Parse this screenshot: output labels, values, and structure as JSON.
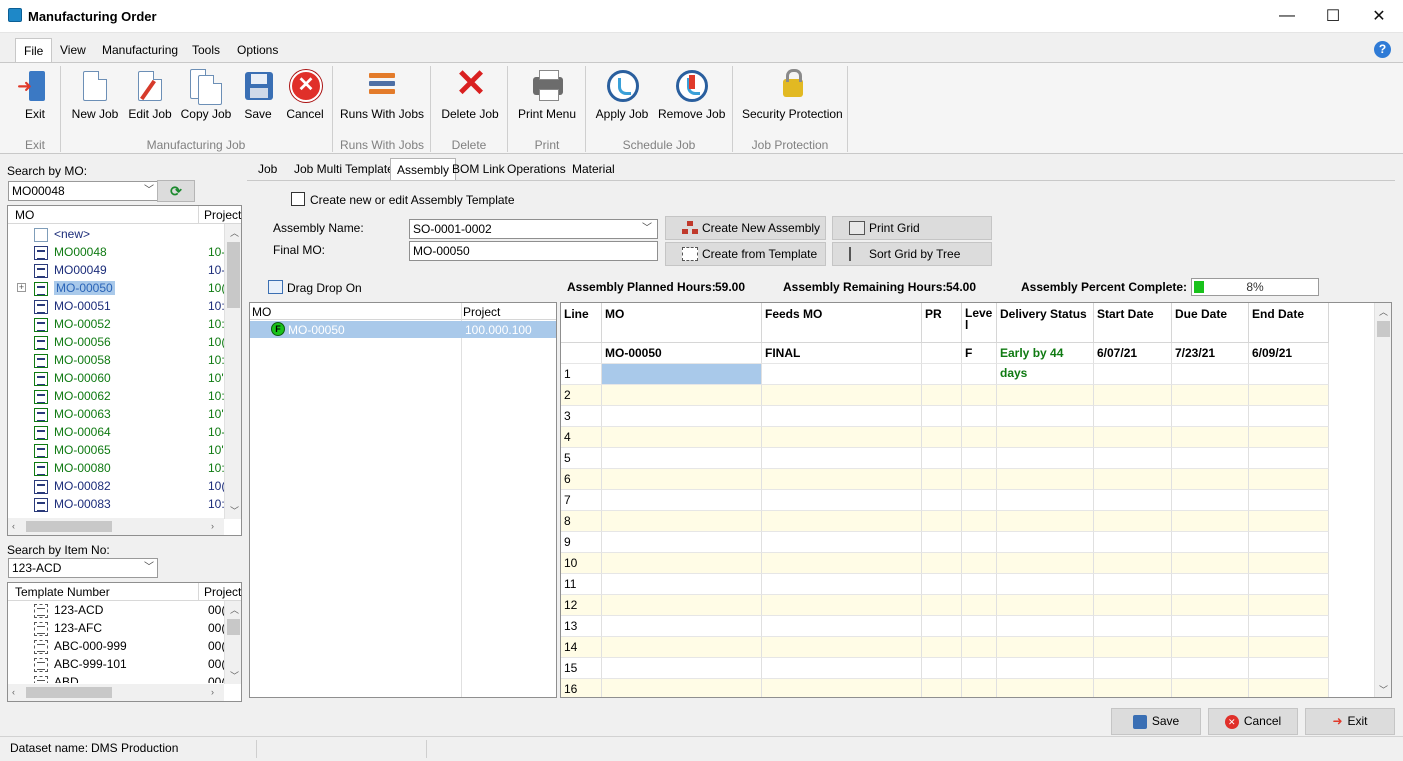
{
  "window": {
    "title": "Manufacturing Order",
    "minimize": "—",
    "maximize": "☐",
    "close": "✕"
  },
  "menu": [
    {
      "label": "File"
    },
    {
      "label": "View"
    },
    {
      "label": "Manufacturing"
    },
    {
      "label": "Tools"
    },
    {
      "label": "Options"
    }
  ],
  "help_icon": "?",
  "ribbon": {
    "buttons": {
      "exit": "Exit",
      "new_job": "New Job",
      "edit_job": "Edit Job",
      "copy_job": "Copy Job",
      "save": "Save",
      "cancel": "Cancel",
      "runs_with_jobs": "Runs With Jobs",
      "delete_job": "Delete Job",
      "print_menu": "Print Menu",
      "apply_job": "Apply Job",
      "remove_job": "Remove Job",
      "security_protection": "Security Protection"
    },
    "groups": {
      "exit": "Exit",
      "manufacturing_job": "Manufacturing Job",
      "runs_with_jobs": "Runs With Jobs",
      "delete": "Delete",
      "print": "Print",
      "schedule_job": "Schedule Job",
      "job_protection": "Job Protection"
    }
  },
  "left": {
    "search_mo_label": "Search by MO:",
    "search_mo_value": "MO00048",
    "mo_tree": {
      "col_mo": "MO",
      "col_project": "Project",
      "rows": [
        {
          "mo": "<new>",
          "project": ""
        },
        {
          "mo": "MO00048",
          "project": "10-"
        },
        {
          "mo": "MO00049",
          "project": "10-"
        },
        {
          "mo": "MO-00050",
          "project": "10("
        },
        {
          "mo": "MO-00051",
          "project": "10:"
        },
        {
          "mo": "MO-00052",
          "project": "10:"
        },
        {
          "mo": "MO-00056",
          "project": "10("
        },
        {
          "mo": "MO-00058",
          "project": "10:"
        },
        {
          "mo": "MO-00060",
          "project": "10'"
        },
        {
          "mo": "MO-00062",
          "project": "10:"
        },
        {
          "mo": "MO-00063",
          "project": "10'"
        },
        {
          "mo": "MO-00064",
          "project": "10-"
        },
        {
          "mo": "MO-00065",
          "project": "10'"
        },
        {
          "mo": "MO-00080",
          "project": "10:"
        },
        {
          "mo": "MO-00082",
          "project": "10("
        },
        {
          "mo": "MO-00083",
          "project": "10:"
        }
      ]
    },
    "search_item_label": "Search by Item No:",
    "search_item_value": "123-ACD",
    "template_tree": {
      "col_template": "Template Number",
      "col_project": "Project",
      "rows": [
        {
          "name": "123-ACD",
          "project": "00("
        },
        {
          "name": "123-AFC",
          "project": "00("
        },
        {
          "name": "ABC-000-999",
          "project": "00("
        },
        {
          "name": "ABC-999-101",
          "project": "00("
        },
        {
          "name": "ABD",
          "project": "00("
        }
      ]
    }
  },
  "tabs": [
    {
      "label": "Job"
    },
    {
      "label": "Job Multi Template"
    },
    {
      "label": "Assembly"
    },
    {
      "label": "BOM Link"
    },
    {
      "label": "Operations"
    },
    {
      "label": "Material"
    }
  ],
  "assembly": {
    "create_template_label": "Create new or edit Assembly Template",
    "assembly_name_label": "Assembly Name:",
    "assembly_name_value": "SO-0001-0002",
    "final_mo_label": "Final MO:",
    "final_mo_value": "MO-00050",
    "buttons": {
      "create_new_assembly": "Create New Assembly",
      "print_grid": "Print Grid",
      "create_from_template": "Create from Template",
      "sort_grid_by_tree": "Sort Grid by Tree"
    },
    "drag_drop_label": "Drag Drop On",
    "planned_hours_label": "Assembly Planned Hours:",
    "planned_hours_value": "59.00",
    "remaining_hours_label": "Assembly Remaining Hours:",
    "remaining_hours_value": "54.00",
    "percent_complete_label": "Assembly Percent Complete:",
    "percent_complete_text": "8%",
    "percent_complete": 0.08,
    "mid_tree": {
      "col_mo": "MO",
      "col_project": "Project",
      "row": {
        "badge": "F",
        "mo": "MO-00050",
        "project": "100.000.100"
      }
    },
    "grid": {
      "headers": [
        "Line",
        "MO",
        "Feeds MO",
        "PR",
        "Leve l",
        "Delivery Status",
        "Start Date",
        "Due Date",
        "End Date"
      ],
      "summary": {
        "mo": "MO-00050",
        "feeds": "FINAL",
        "level": "F",
        "status": "Early by 44 days",
        "start": "6/07/21",
        "due": "7/23/21",
        "end": "6/09/21"
      },
      "lines": [
        "1",
        "2",
        "3",
        "4",
        "5",
        "6",
        "7",
        "8",
        "9",
        "10",
        "11",
        "12",
        "13",
        "14",
        "15",
        "16"
      ]
    }
  },
  "footer": {
    "save": "Save",
    "cancel": "Cancel",
    "exit": "Exit"
  },
  "status": {
    "dataset_label": "Dataset name:",
    "dataset_value": "DMS Production"
  },
  "colors": {
    "accent_green": "#0f7a12",
    "selection_blue": "#a9c9ea",
    "row_alt": "#fffce6",
    "progress_green": "#19c21b"
  }
}
